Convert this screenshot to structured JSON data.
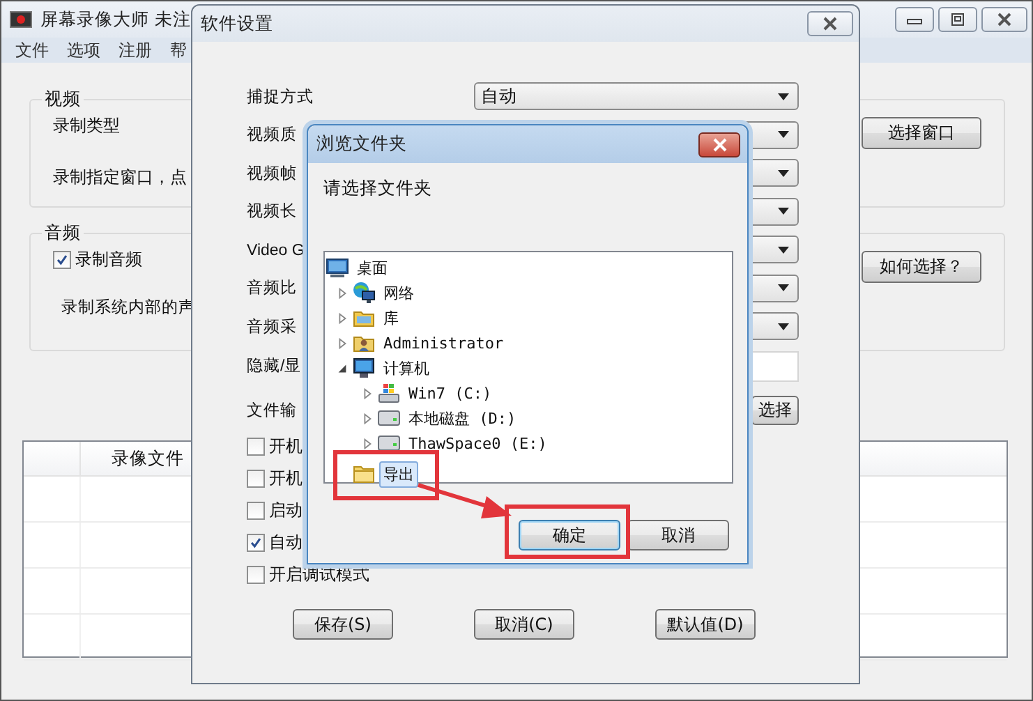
{
  "main_window": {
    "title": "屏幕录像大师 未注",
    "menu": [
      "文件",
      "选项",
      "注册",
      "帮"
    ],
    "video_group": {
      "legend": "视频",
      "type_label": "录制类型",
      "hint": "录制指定窗口，点",
      "button": "选择窗口"
    },
    "audio_group": {
      "legend": "音频",
      "record_audio": {
        "label": "录制音频",
        "checked": true
      },
      "hint": "录制系统内部的声",
      "button": "如何选择？"
    },
    "table": {
      "columns": [
        "录像文件"
      ]
    }
  },
  "settings_window": {
    "title": "软件设置",
    "rows": [
      {
        "kind": "dropdown",
        "label": "捕捉方式",
        "value": "自动"
      },
      {
        "kind": "dropdown",
        "label": "视频质"
      },
      {
        "kind": "dropdown",
        "label": "视频帧"
      },
      {
        "kind": "dropdown",
        "label": "视频长"
      },
      {
        "kind": "dropdown",
        "label": "Video G"
      },
      {
        "kind": "dropdown",
        "label": "音频比"
      },
      {
        "kind": "dropdown",
        "label": "音频采"
      },
      {
        "kind": "field",
        "label": "隐藏/显"
      },
      {
        "kind": "button",
        "label": "文件输",
        "button": "选择"
      }
    ],
    "options": [
      {
        "label": "开机",
        "checked": false
      },
      {
        "label": "开机",
        "checked": false
      },
      {
        "label": "启动",
        "checked": false
      },
      {
        "label": "自动",
        "checked": true
      },
      {
        "label": "开启调试模式",
        "checked": false
      }
    ],
    "buttons": [
      "保存(S)",
      "取消(C)",
      "默认值(D)"
    ]
  },
  "browse_dialog": {
    "title": "浏览文件夹",
    "prompt": "请选择文件夹",
    "tree": [
      {
        "label": "桌面",
        "kind": "desktop",
        "selected": false,
        "children": [
          {
            "label": "网络",
            "kind": "network",
            "selected": false,
            "expanded": false
          },
          {
            "label": "库",
            "kind": "library",
            "selected": false,
            "expanded": false
          },
          {
            "label": "Administrator",
            "kind": "user",
            "selected": false,
            "expanded": false
          },
          {
            "label": "计算机",
            "kind": "computer",
            "selected": false,
            "expanded": true,
            "children": [
              {
                "label": "Win7 (C:)",
                "kind": "system-drive",
                "selected": false,
                "expanded": false
              },
              {
                "label": "本地磁盘 (D:)",
                "kind": "drive",
                "selected": false,
                "expanded": false
              },
              {
                "label": "ThawSpace0 (E:)",
                "kind": "drive",
                "selected": false,
                "expanded": false
              }
            ]
          },
          {
            "label": "导出",
            "kind": "folder",
            "selected": true
          }
        ]
      }
    ],
    "buttons": [
      {
        "label": "确定",
        "default": true
      },
      {
        "label": "取消",
        "default": false
      }
    ]
  }
}
